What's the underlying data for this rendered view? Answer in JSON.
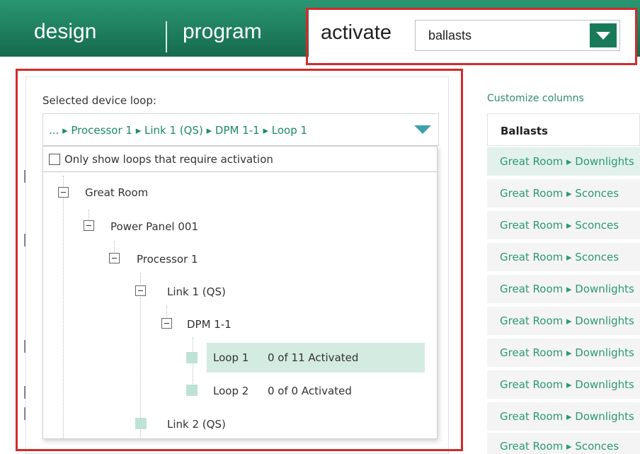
{
  "nav": {
    "design": "design",
    "program": "program",
    "activate": "activate",
    "activate_select_value": "ballasts"
  },
  "loop_panel": {
    "label": "Selected device loop:",
    "path": "... ▸ Processor 1 ▸ Link 1 (QS) ▸ DPM 1-1 ▸ Loop 1",
    "only_show_label": "Only show loops that require activation",
    "only_show_checked": false,
    "tree": {
      "great_room": "Great Room",
      "power_panel": "Power Panel 001",
      "processor": "Processor 1",
      "link1": "Link 1 (QS)",
      "dpm": "DPM 1-1",
      "loop1": "Loop 1",
      "loop1_status": "0 of 11 Activated",
      "loop2": "Loop 2",
      "loop2_status": "0 of 0 Activated",
      "link2": "Link 2 (QS)"
    }
  },
  "ballasts_panel": {
    "customize_columns": "Customize columns",
    "header": "Ballasts",
    "rows": [
      "Great Room ▸ Downlights",
      "Great Room ▸ Sconces",
      "Great Room ▸ Sconces",
      "Great Room ▸ Sconces",
      "Great Room ▸ Downlights",
      "Great Room ▸ Downlights",
      "Great Room ▸ Downlights",
      "Great Room ▸ Downlights",
      "Great Room ▸ Downlights",
      "Great Room ▸ Sconces"
    ]
  },
  "colors": {
    "nav_green": "#1d7c5c",
    "accent_green": "#2b9a74",
    "highlight_box": "#d42a2a",
    "selected_row": "#d4ebe2"
  },
  "icons": {
    "select_button": "triangle-down-icon",
    "loop_caret": "triangle-down-icon",
    "tree_toggle": "minus-box-icon",
    "tree_leaf": "square-leaf-icon"
  }
}
